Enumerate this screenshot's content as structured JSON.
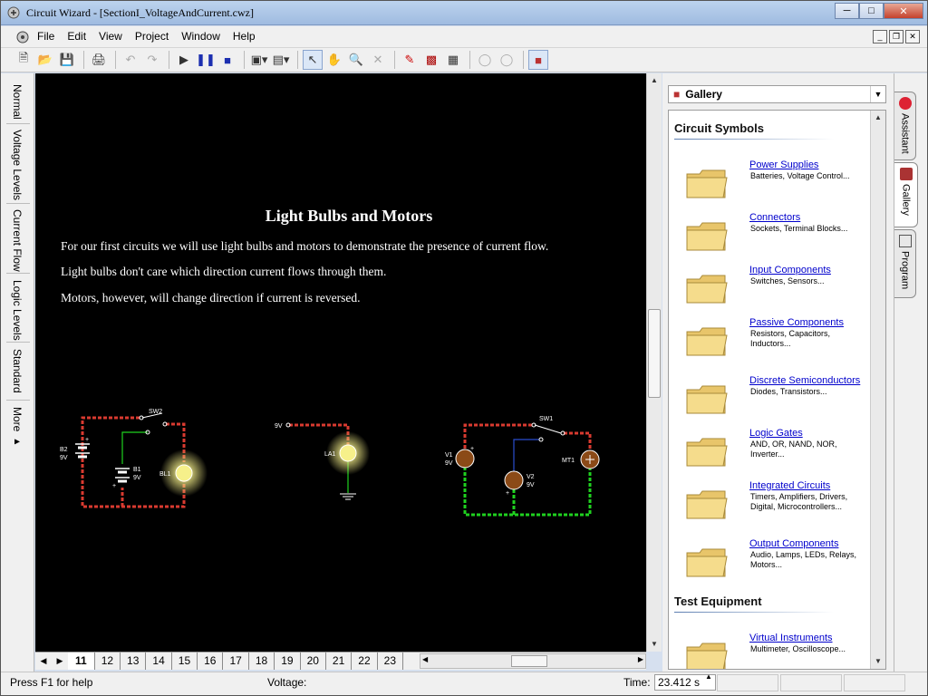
{
  "window": {
    "title": "Circuit Wizard - [SectionI_VoltageAndCurrent.cwz]"
  },
  "menu": [
    "File",
    "Edit",
    "View",
    "Project",
    "Window",
    "Help"
  ],
  "left_tabs": [
    "Normal",
    "Voltage Levels",
    "Current Flow",
    "Logic Levels",
    "Standard",
    "More ▸"
  ],
  "slide": {
    "title": "Light Bulbs and Motors",
    "lines": [
      "For our first circuits we will use light bulbs and motors to demonstrate the presence of current flow.",
      "Light bulbs don't care which direction current flows through them.",
      "Motors, however, will change direction if current is reversed."
    ]
  },
  "circuit_labels": {
    "sw2": "SW2",
    "b2": "B2",
    "b2v": "9V",
    "b1": "B1",
    "b1v": "9V",
    "bl1": "BL1",
    "v9": "9V",
    "la1": "LA1",
    "sw1": "SW1",
    "v1": "V1",
    "v1v": "9V",
    "v2": "V2",
    "v2v": "9V",
    "mt1": "MT1",
    "plus": "+"
  },
  "page_tabs": [
    "11",
    "12",
    "13",
    "14",
    "15",
    "16",
    "17",
    "18",
    "19",
    "20",
    "21",
    "22",
    "23"
  ],
  "active_page": "11",
  "gallery": {
    "selected": "Gallery",
    "sections": [
      {
        "heading": "Circuit Symbols",
        "items": [
          {
            "name": "Power Supplies",
            "desc": "Batteries, Voltage Control..."
          },
          {
            "name": "Connectors",
            "desc": "Sockets, Terminal Blocks..."
          },
          {
            "name": "Input Components",
            "desc": "Switches, Sensors..."
          },
          {
            "name": "Passive Components",
            "desc": "Resistors, Capacitors, Inductors..."
          },
          {
            "name": "Discrete Semiconductors",
            "desc": "Diodes, Transistors..."
          },
          {
            "name": "Logic Gates",
            "desc": "AND, OR, NAND, NOR, Inverter..."
          },
          {
            "name": "Integrated Circuits",
            "desc": "Timers, Amplifiers, Drivers, Digital, Microcontrollers..."
          },
          {
            "name": "Output Components",
            "desc": "Audio, Lamps, LEDs, Relays, Motors..."
          }
        ]
      },
      {
        "heading": "Test Equipment",
        "items": [
          {
            "name": "Virtual Instruments",
            "desc": "Multimeter, Oscilloscope..."
          }
        ]
      }
    ]
  },
  "right_tabs": [
    "Assistant",
    "Gallery",
    "Program"
  ],
  "status": {
    "help": "Press F1 for help",
    "voltage_label": "Voltage:",
    "time_label": "Time:",
    "time_value": "23.412 s"
  },
  "colors": {
    "wire_red": "#d93a30",
    "wire_green": "#1fd11f",
    "wire_blue": "#2a4ecf",
    "canvas_bg": "#000000",
    "link": "#0000cc"
  }
}
